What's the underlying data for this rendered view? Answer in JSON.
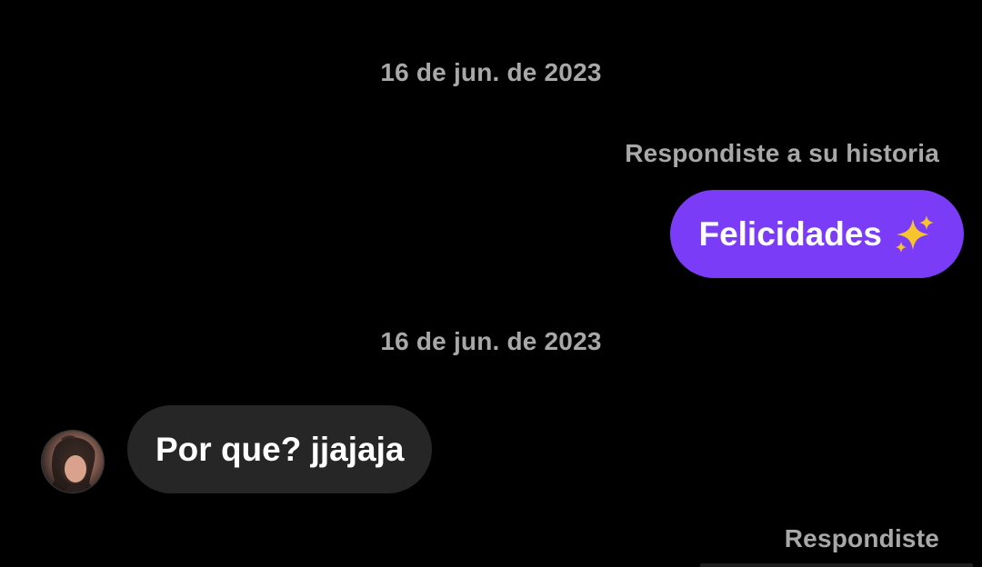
{
  "conversation": {
    "messages": [
      {
        "date_separator": "16 de jun. de 2023",
        "reply_context": "Respondiste a su historia",
        "direction": "outgoing",
        "text": "Felicidades",
        "emoji": "sparkles-emoji",
        "bubble_color": "#7a3cf6"
      },
      {
        "date_separator": "16 de jun. de 2023",
        "direction": "incoming",
        "text": "Por que? jjajaja",
        "bubble_color": "#262626",
        "avatar": "contact-avatar"
      },
      {
        "reply_context": "Respondiste",
        "direction": "outgoing"
      }
    ]
  },
  "theme": {
    "background": "#000000",
    "muted_text": "#a8a8a8",
    "text": "#ffffff"
  }
}
